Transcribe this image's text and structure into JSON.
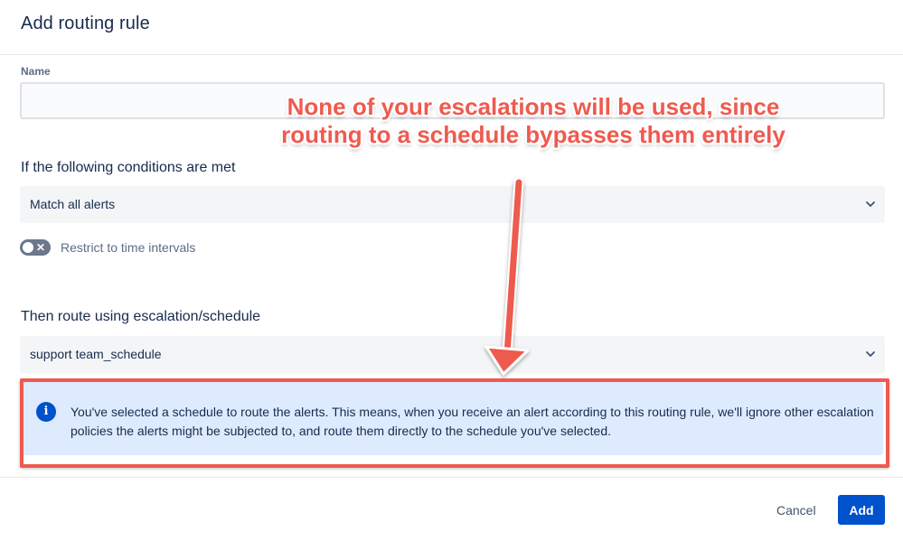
{
  "dialog": {
    "title": "Add routing rule",
    "name_label": "Name",
    "name_value": "",
    "conditions_label": "If the following conditions are met",
    "conditions_value": "Match all alerts",
    "toggle_label": "Restrict to time intervals",
    "toggle_on": false,
    "route_label": "Then route using escalation/schedule",
    "route_value": "support team_schedule",
    "info_text": "You've selected a schedule to route the alerts. This means, when you receive an alert according to this routing rule, we'll ignore other escalation policies the alerts might be subjected to, and route them directly to the schedule you've selected.",
    "cancel_label": "Cancel",
    "add_label": "Add"
  },
  "annotation": {
    "line1": "None of your escalations will be used, since",
    "line2": "routing to a schedule bypasses them entirely"
  },
  "colors": {
    "primary": "#0052cc",
    "info_bg": "#deebff",
    "annotation": "#ef5a4f"
  }
}
